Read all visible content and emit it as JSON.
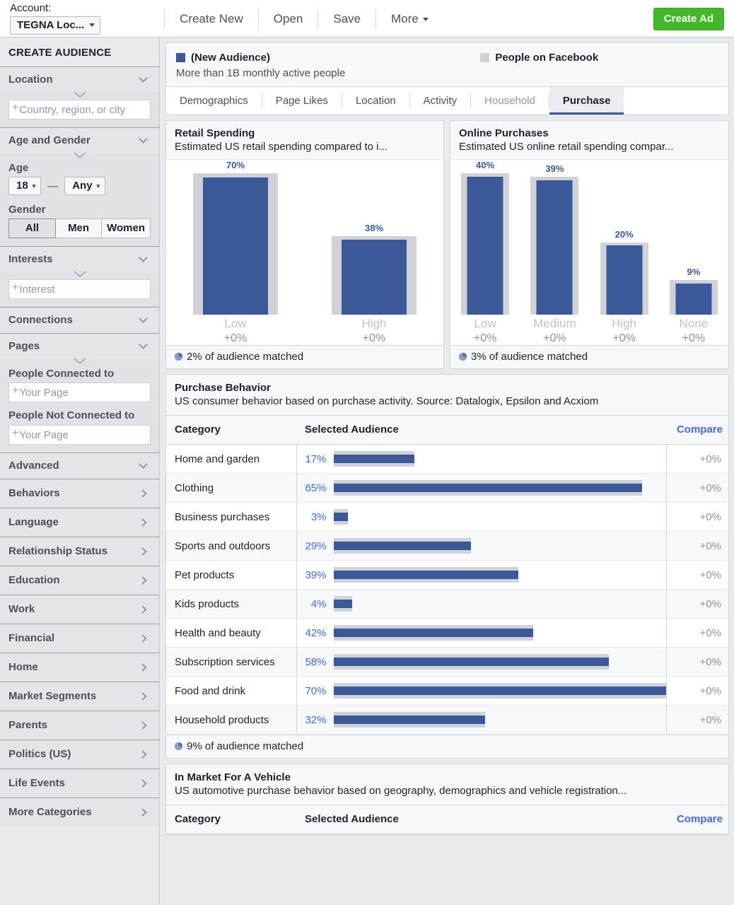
{
  "topbar": {
    "account_label": "Account:",
    "account_value": "TEGNA Loc...",
    "menu": [
      "Create New",
      "Open",
      "Save",
      "More"
    ],
    "more_has_caret": true,
    "create_ad": "Create Ad",
    "create_ad_color": "#42b72a"
  },
  "sidebar": {
    "title": "CREATE AUDIENCE",
    "location": {
      "label": "Location",
      "placeholder": "Country, region, or city"
    },
    "age_gender": {
      "label": "Age and Gender",
      "age_label": "Age",
      "age_min": "18",
      "age_max": "Any",
      "dash": "—",
      "gender_label": "Gender",
      "gender_options": [
        "All",
        "Men",
        "Women"
      ],
      "gender_selected": "All"
    },
    "interests": {
      "label": "Interests",
      "placeholder": "Interest"
    },
    "connections": {
      "label": "Connections"
    },
    "pages": {
      "label": "Pages",
      "connected_label": "People Connected to",
      "connected_placeholder": "Your Page",
      "not_connected_label": "People Not Connected to",
      "not_connected_placeholder": "Your Page"
    },
    "advanced": {
      "label": "Advanced"
    },
    "categories": [
      "Behaviors",
      "Language",
      "Relationship Status",
      "Education",
      "Work",
      "Financial",
      "Home",
      "Market Segments",
      "Parents",
      "Politics (US)",
      "Life Events",
      "More Categories"
    ]
  },
  "legend": {
    "series_a": "(New Audience)",
    "series_a_color": "#3b5998",
    "series_b": "People on Facebook",
    "series_b_color": "#d0d2d7",
    "subtitle": "More than 1B monthly active people"
  },
  "tabs": {
    "items": [
      {
        "label": "Demographics",
        "state": "normal"
      },
      {
        "label": "Page Likes",
        "state": "normal"
      },
      {
        "label": "Location",
        "state": "normal"
      },
      {
        "label": "Activity",
        "state": "normal"
      },
      {
        "label": "Household",
        "state": "dim"
      },
      {
        "label": "Purchase",
        "state": "active"
      }
    ]
  },
  "chart_data": [
    {
      "type": "bar",
      "title": "Retail Spending",
      "subtitle": "Estimated US retail spending compared to i...",
      "categories": [
        "Low",
        "High"
      ],
      "values": [
        70,
        38
      ],
      "value_labels": [
        "70%",
        "38%"
      ],
      "comparison_values": [
        72,
        40
      ],
      "deltas": [
        "+0%",
        "+0%"
      ],
      "ylim": [
        0,
        75
      ],
      "footer": "2% of audience matched",
      "xlabel": "",
      "ylabel": "",
      "grid": false,
      "legend_position": "top"
    },
    {
      "type": "bar",
      "title": "Online Purchases",
      "subtitle": "Estimated US online retail spending compar...",
      "categories": [
        "Low",
        "Medium",
        "High",
        "None"
      ],
      "values": [
        40,
        39,
        20,
        9
      ],
      "value_labels": [
        "40%",
        "39%",
        "20%",
        "9%"
      ],
      "comparison_values": [
        41,
        40,
        21,
        10
      ],
      "deltas": [
        "+0%",
        "+0%",
        "+0%",
        "+0%"
      ],
      "ylim": [
        0,
        43
      ],
      "footer": "3% of audience matched",
      "xlabel": "",
      "ylabel": "",
      "grid": false,
      "legend_position": "top"
    },
    {
      "type": "bar",
      "orientation": "horizontal",
      "title": "Purchase Behavior",
      "subtitle": "US consumer behavior based on purchase activity. Source: Datalogix, Epsilon and Acxiom",
      "columns": [
        "Category",
        "Selected Audience",
        "Compare"
      ],
      "categories": [
        "Home and garden",
        "Clothing",
        "Business purchases",
        "Sports and outdoors",
        "Pet products",
        "Kids products",
        "Health and beauty",
        "Subscription services",
        "Food and drink",
        "Household products"
      ],
      "values": [
        17,
        65,
        3,
        29,
        39,
        4,
        42,
        58,
        70,
        32
      ],
      "value_labels": [
        "17%",
        "65%",
        "3%",
        "29%",
        "39%",
        "4%",
        "42%",
        "58%",
        "70%",
        "32%"
      ],
      "deltas": [
        "+0%",
        "+0%",
        "+0%",
        "+0%",
        "+0%",
        "+0%",
        "+0%",
        "+0%",
        "+0%",
        "+0%"
      ],
      "ylim": [
        0,
        70
      ],
      "footer": "9% of audience matched"
    }
  ],
  "vehicle_table": {
    "title": "In Market For A Vehicle",
    "subtitle": "US automotive purchase behavior based on geography, demographics and vehicle registration...",
    "columns": [
      "Category",
      "Selected Audience",
      "Compare"
    ]
  }
}
